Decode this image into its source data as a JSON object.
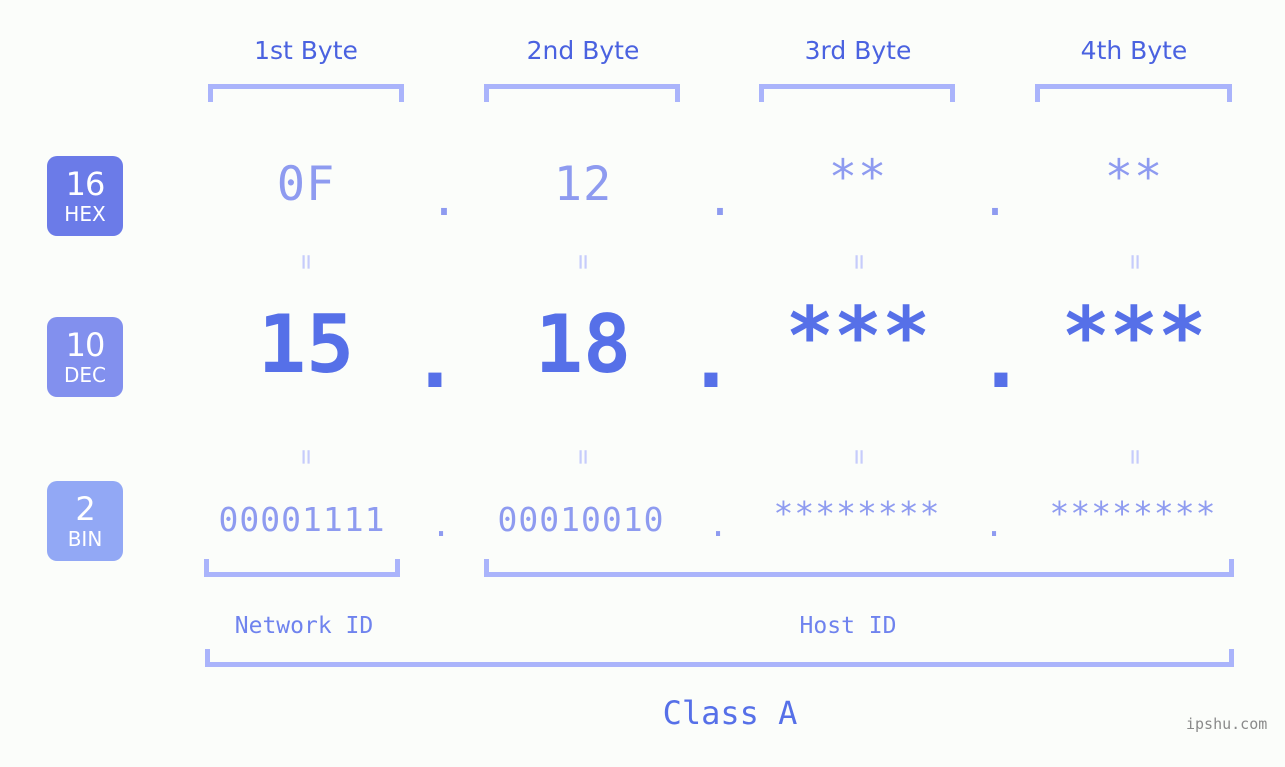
{
  "meta": {
    "background_color": "#fbfdfa",
    "accent_color": "#5670e8",
    "muted_color": "#8e9bf0",
    "bracket_color": "#aab4fb",
    "equals_color": "#c6ccfb"
  },
  "headers": [
    {
      "label": "1st Byte"
    },
    {
      "label": "2nd Byte"
    },
    {
      "label": "3rd Byte"
    },
    {
      "label": "4th Byte"
    }
  ],
  "rows": [
    {
      "badge_num": "16",
      "badge_sys": "HEX",
      "badge_color": "#6b7be8",
      "values": [
        "0F",
        "12",
        "**",
        "**"
      ],
      "separator": "."
    },
    {
      "badge_num": "10",
      "badge_sys": "DEC",
      "badge_color": "#8290ee",
      "values": [
        "15",
        "18",
        "***",
        "***"
      ],
      "separator": "."
    },
    {
      "badge_num": "2",
      "badge_sys": "BIN",
      "badge_color": "#92a8f5",
      "values": [
        "00001111",
        "00010010",
        "********",
        "********"
      ],
      "separator": "."
    }
  ],
  "equals": {
    "glyph": "="
  },
  "sections": [
    {
      "label": "Network ID"
    },
    {
      "label": "Host ID"
    }
  ],
  "class": {
    "label": "Class A"
  },
  "watermark": {
    "text": "ipshu.com"
  }
}
